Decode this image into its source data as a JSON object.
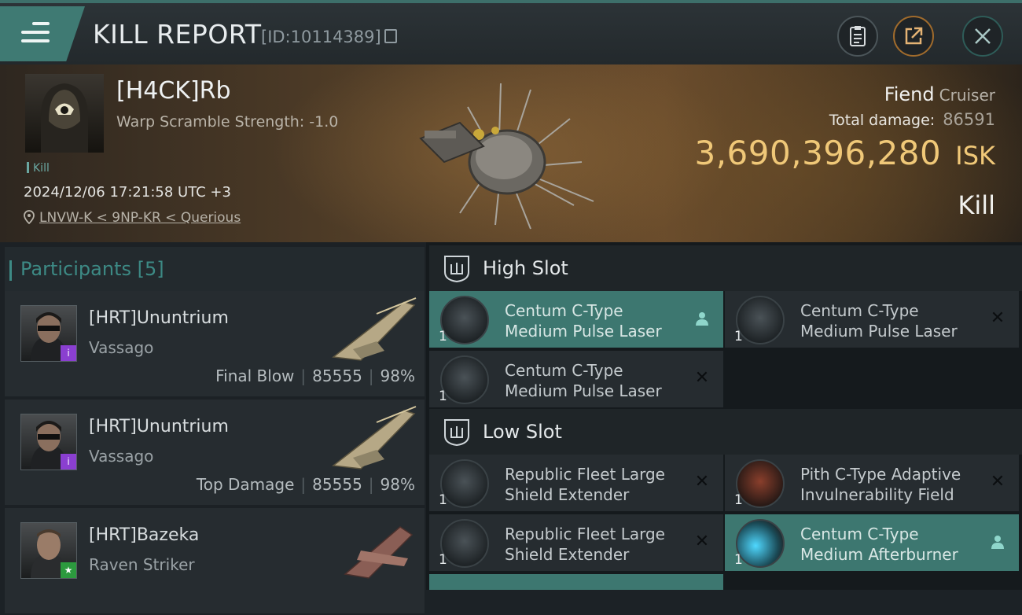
{
  "header": {
    "title": "KILL REPORT",
    "kill_id": "[ID:10114389]"
  },
  "victim": {
    "name": "[H4CK]Rb",
    "warp_scramble": "Warp Scramble Strength: -1.0",
    "tag": "Kill",
    "datetime": "2024/12/06 17:21:58 UTC +3",
    "location": "LNVW-K < 9NP-KR < Querious",
    "ship_name": "Fiend",
    "ship_class": "Cruiser",
    "total_damage_label": "Total damage:",
    "total_damage": "86591",
    "isk_value": "3,690,396,280",
    "isk_unit": "ISK",
    "result": "Kill"
  },
  "participants": {
    "label": "Participants",
    "count": "[5]",
    "rows": [
      {
        "name": "[HRT]Ununtrium",
        "ship": "Vassago",
        "role": "Final Blow",
        "damage": "85555",
        "percent": "98%"
      },
      {
        "name": "[HRT]Ununtrium",
        "ship": "Vassago",
        "role": "Top Damage",
        "damage": "85555",
        "percent": "98%"
      },
      {
        "name": "[HRT]Bazeka",
        "ship": "Raven Striker"
      }
    ]
  },
  "slots": {
    "high_label": "High Slot",
    "low_label": "Low Slot",
    "high": [
      {
        "qty": "1",
        "line1": "Centum C-Type",
        "line2": "Medium Pulse Laser"
      },
      {
        "qty": "1",
        "line1": "Centum C-Type",
        "line2": "Medium Pulse Laser"
      },
      {
        "qty": "1",
        "line1": "Centum C-Type",
        "line2": "Medium Pulse Laser"
      }
    ],
    "low": [
      {
        "qty": "1",
        "line1": "Republic Fleet Large",
        "line2": "Shield Extender"
      },
      {
        "qty": "1",
        "line1": "Pith C-Type Adaptive",
        "line2": "Invulnerability Field"
      },
      {
        "qty": "1",
        "line1": "Republic Fleet Large",
        "line2": "Shield Extender"
      },
      {
        "qty": "1",
        "line1": "Centum C-Type",
        "line2": "Medium Afterburner"
      }
    ]
  },
  "colors": {
    "accent_teal": "#3d7770",
    "isk_gold": "#f0c878"
  }
}
